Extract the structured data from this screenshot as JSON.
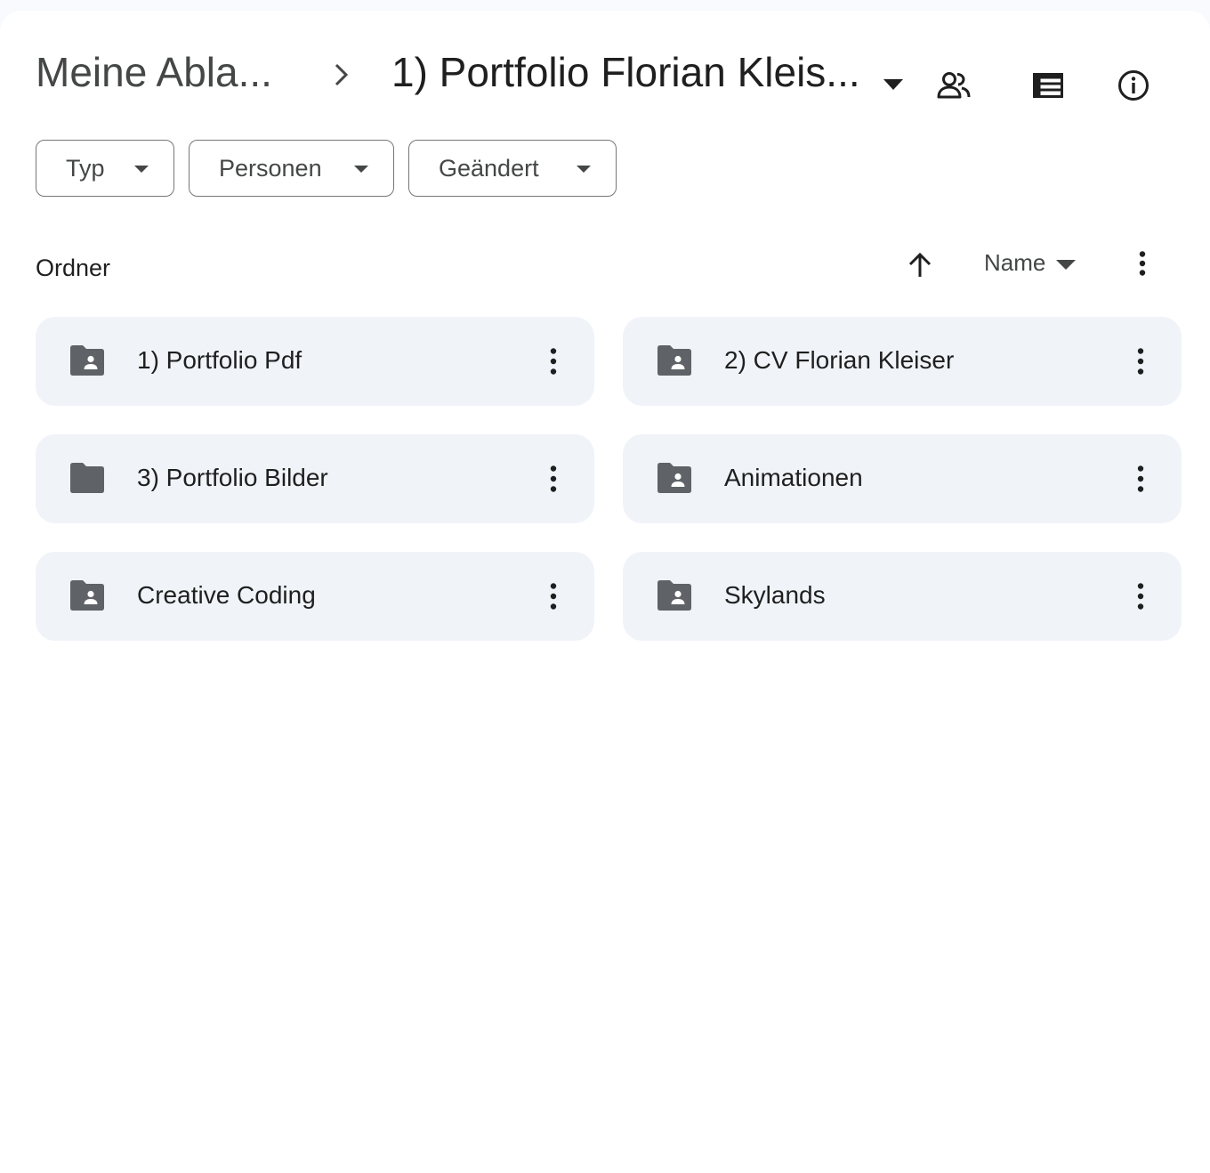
{
  "breadcrumb": {
    "root": "Meine Abla...",
    "current": "1) Portfolio Florian Kleis..."
  },
  "header_icons": {
    "share": "people-icon",
    "layout": "list-view-icon",
    "info": "info-icon"
  },
  "filters": [
    {
      "label": "Typ"
    },
    {
      "label": "Personen"
    },
    {
      "label": "Geändert"
    }
  ],
  "section": {
    "title": "Ordner",
    "sort_direction": "ascending",
    "sort_field": "Name"
  },
  "folders": [
    {
      "name": "1) Portfolio Pdf",
      "icon": "shared-folder-icon"
    },
    {
      "name": "2) CV Florian Kleiser",
      "icon": "shared-folder-icon"
    },
    {
      "name": "3) Portfolio Bilder",
      "icon": "folder-icon"
    },
    {
      "name": "Animationen",
      "icon": "shared-folder-icon"
    },
    {
      "name": "Creative Coding",
      "icon": "shared-folder-icon"
    },
    {
      "name": "Skylands",
      "icon": "shared-folder-icon"
    }
  ],
  "colors": {
    "card_bg": "#f0f4f9",
    "icon": "#5f6368",
    "text": "#1f1f1f",
    "muted_text": "#444746"
  }
}
